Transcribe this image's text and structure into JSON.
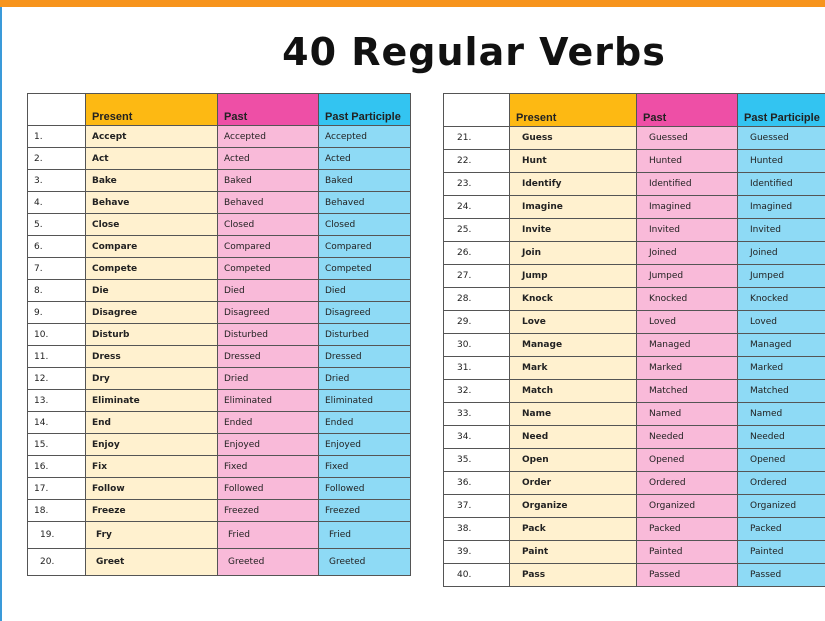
{
  "title": "40 Regular Verbs",
  "headers": {
    "present": "Present",
    "past": "Past",
    "past_participle": "Past Participle"
  },
  "left_rows": [
    [
      "1.",
      "Accept",
      "Accepted",
      "Accepted"
    ],
    [
      "2.",
      "Act",
      "Acted",
      "Acted"
    ],
    [
      "3.",
      "Bake",
      "Baked",
      "Baked"
    ],
    [
      "4.",
      "Behave",
      "Behaved",
      "Behaved"
    ],
    [
      "5.",
      "Close",
      "Closed",
      "Closed"
    ],
    [
      "6.",
      "Compare",
      "Compared",
      "Compared"
    ],
    [
      "7.",
      "Compete",
      "Competed",
      "Competed"
    ],
    [
      "8.",
      "Die",
      "Died",
      "Died"
    ],
    [
      "9.",
      "Disagree",
      "Disagreed",
      "Disagreed"
    ],
    [
      "10.",
      "Disturb",
      "Disturbed",
      "Disturbed"
    ],
    [
      "11.",
      "Dress",
      "Dressed",
      "Dressed"
    ],
    [
      "12.",
      "Dry",
      "Dried",
      "Dried"
    ],
    [
      "13.",
      "Eliminate",
      "Eliminated",
      "Eliminated"
    ],
    [
      "14.",
      "End",
      "Ended",
      "Ended"
    ],
    [
      "15.",
      "Enjoy",
      "Enjoyed",
      "Enjoyed"
    ],
    [
      "16.",
      "Fix",
      "Fixed",
      "Fixed"
    ],
    [
      "17.",
      "Follow",
      "Followed",
      "Followed"
    ],
    [
      "18.",
      "Freeze",
      "Freezed",
      "Freezed"
    ],
    [
      "19.",
      "Fry",
      "Fried",
      "Fried"
    ],
    [
      "20.",
      "Greet",
      "Greeted",
      "Greeted"
    ]
  ],
  "right_rows": [
    [
      "21.",
      "Guess",
      "Guessed",
      "Guessed"
    ],
    [
      "22.",
      "Hunt",
      "Hunted",
      "Hunted"
    ],
    [
      "23.",
      "Identify",
      "Identified",
      "Identified"
    ],
    [
      "24.",
      "Imagine",
      "Imagined",
      "Imagined"
    ],
    [
      "25.",
      "Invite",
      "Invited",
      "Invited"
    ],
    [
      "26.",
      "Join",
      "Joined",
      "Joined"
    ],
    [
      "27.",
      "Jump",
      "Jumped",
      "Jumped"
    ],
    [
      "28.",
      "Knock",
      "Knocked",
      "Knocked"
    ],
    [
      "29.",
      "Love",
      "Loved",
      "Loved"
    ],
    [
      "30.",
      "Manage",
      "Managed",
      "Managed"
    ],
    [
      "31.",
      "Mark",
      "Marked",
      "Marked"
    ],
    [
      "32.",
      "Match",
      "Matched",
      "Matched"
    ],
    [
      "33.",
      "Name",
      "Named",
      "Named"
    ],
    [
      "34.",
      "Need",
      "Needed",
      "Needed"
    ],
    [
      "35.",
      "Open",
      "Opened",
      "Opened"
    ],
    [
      "36.",
      "Order",
      "Ordered",
      "Ordered"
    ],
    [
      "37.",
      "Organize",
      "Organized",
      "Organized"
    ],
    [
      "38.",
      "Pack",
      "Packed",
      "Packed"
    ],
    [
      "39.",
      "Paint",
      "Painted",
      "Painted"
    ],
    [
      "40.",
      "Pass",
      "Passed",
      "Passed"
    ]
  ],
  "colors": {
    "accent_bar": "#f7941d",
    "present_header": "#fdb913",
    "past_header": "#ee4fa6",
    "past_participle_header": "#33c4f1"
  }
}
